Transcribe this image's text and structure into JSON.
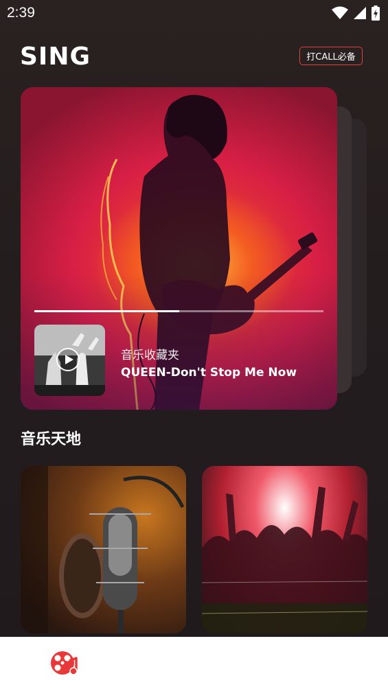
{
  "status_bar": {
    "time": "2:39",
    "icons": [
      "wifi-icon",
      "signal-icon",
      "battery-icon"
    ]
  },
  "header": {
    "app_title": "SING",
    "call_button_label": "打CALL必备"
  },
  "now_playing": {
    "playlist_label": "音乐收藏夹",
    "track_title": "QUEEN-Don't Stop Me Now",
    "progress": 0.5
  },
  "section": {
    "title": "音乐天地"
  },
  "bottom_nav": {
    "items": [
      {
        "icon": "music-disc-icon",
        "color": "#e8383a"
      }
    ]
  },
  "colors": {
    "accent": "#e8383a",
    "background": "#241d1e"
  }
}
